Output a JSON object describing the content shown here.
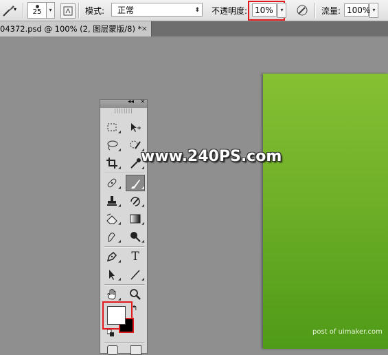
{
  "options_bar": {
    "brush_size": "25",
    "mode_label": "模式:",
    "mode_value": "正常",
    "opacity_label": "不透明度:",
    "opacity_value": "10%",
    "flow_label": "流量:",
    "flow_value": "100%"
  },
  "document_tab": {
    "title": "04372.psd @ 100% (2, 图层蒙版/8) *",
    "close_glyph": "×"
  },
  "tools_panel": {
    "collapse_glyph": "◂◂",
    "close_glyph": "×",
    "type_tool_glyph": "T"
  },
  "watermarks": {
    "site": "www.240PS.com",
    "credit": "post of uimaker.com"
  },
  "colors": {
    "highlight": "#e01a1a",
    "canvas_top": "#86c033",
    "canvas_bottom": "#4f9a18",
    "foreground": "#ffffff",
    "background": "#000000"
  }
}
